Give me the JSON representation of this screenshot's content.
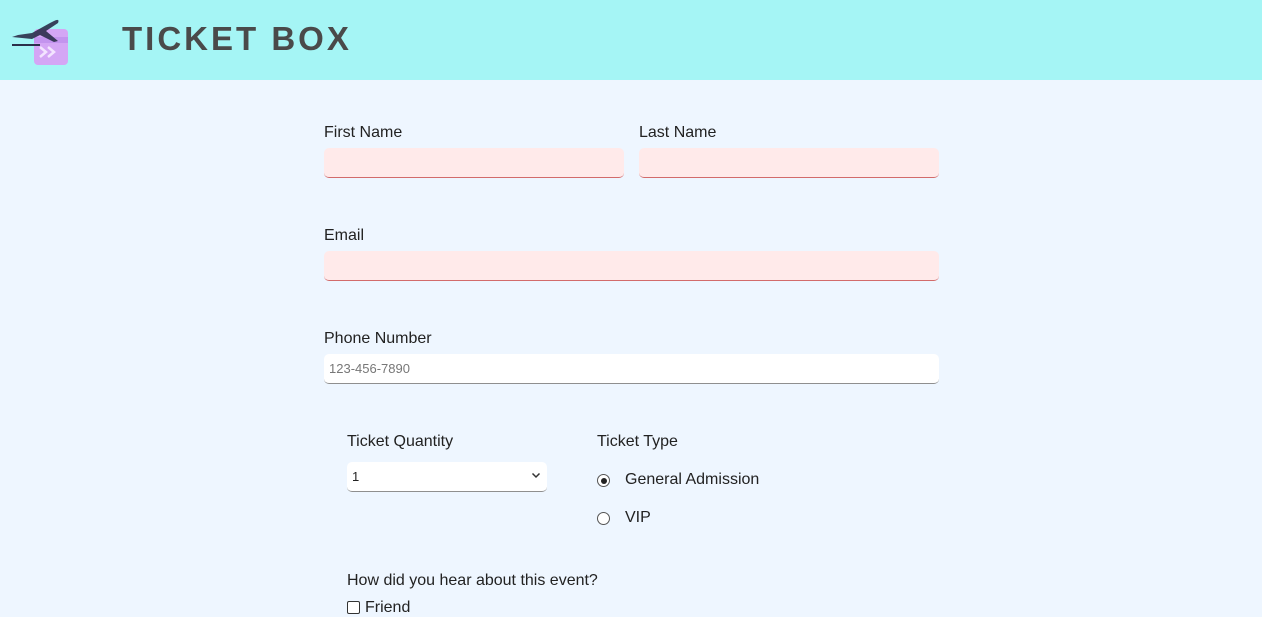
{
  "header": {
    "brand": "TICKET BOX",
    "logo_icon": "plane-ticket-icon",
    "background": "#a5f5f5"
  },
  "form": {
    "first_name": {
      "label": "First Name",
      "value": ""
    },
    "last_name": {
      "label": "Last Name",
      "value": ""
    },
    "email": {
      "label": "Email",
      "value": ""
    },
    "phone": {
      "label": "Phone Number",
      "value": "",
      "placeholder": "123-456-7890"
    },
    "ticket_quantity": {
      "label": "Ticket Quantity",
      "selected": "1"
    },
    "ticket_type": {
      "label": "Ticket Type",
      "options": [
        {
          "label": "General Admission",
          "checked": true
        },
        {
          "label": "VIP",
          "checked": false
        }
      ]
    },
    "referral": {
      "question": "How did you hear about this event?",
      "options": [
        {
          "label": "Friend",
          "checked": false
        }
      ]
    }
  },
  "colors": {
    "page_bg": "#eef6ff",
    "invalid_field_bg": "#ffeaea",
    "invalid_field_border": "#d26b6b",
    "brand_text": "#4a4a4a"
  }
}
